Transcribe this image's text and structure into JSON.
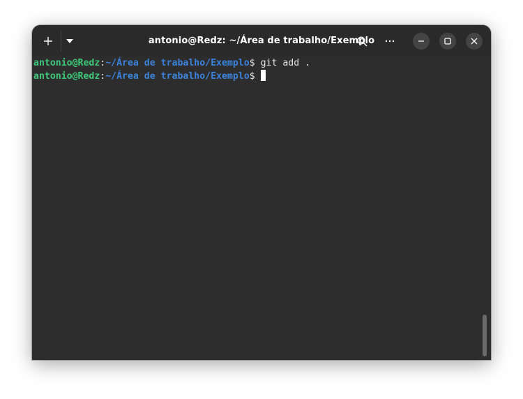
{
  "window": {
    "title": "antonio@Redz: ~/Área de trabalho/Exemplo"
  },
  "titlebar": {
    "icons": {
      "new_tab": "plus-icon",
      "tab_menu": "chevron-down-icon",
      "search": "search-icon",
      "menu": "more-horizontal-icon",
      "minimize": "minimize-icon",
      "maximize": "maximize-icon",
      "close": "close-icon"
    }
  },
  "terminal": {
    "lines": [
      {
        "user": "antonio@Redz",
        "colon": ":",
        "path": "~/Área de trabalho/Exemplo",
        "prompt": "$",
        "command": " git add ."
      },
      {
        "user": "antonio@Redz",
        "colon": ":",
        "path": "~/Área de trabalho/Exemplo",
        "prompt": "$",
        "command": " "
      }
    ]
  },
  "colors": {
    "background": "#2d2d2d",
    "titlebar": "#2a2a2a",
    "user": "#3ec87a",
    "path": "#3b82db",
    "text": "#e6e6e6"
  }
}
